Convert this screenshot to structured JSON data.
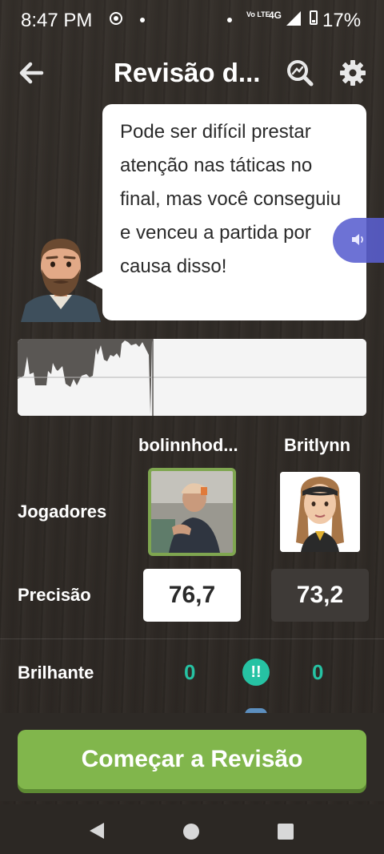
{
  "status_bar": {
    "time": "8:47 PM",
    "network_volte": "Vo LTE",
    "network_type": "4G",
    "battery": "17%"
  },
  "header": {
    "title": "Revisão d...",
    "back_icon": "arrow-left-icon",
    "search_icon": "magnifier-icon",
    "settings_icon": "gear-icon"
  },
  "coach": {
    "message": "Pode ser difícil prestar atenção nas táticas no final, mas você conseguiu e venceu a partida por causa disso!",
    "audio_icon": "speaker-icon"
  },
  "players": {
    "player1_name": "bolinnhod...",
    "player2_name": "Britlynn"
  },
  "labels": {
    "players": "Jogadores",
    "accuracy": "Precisão",
    "brilliant": "Brilhante"
  },
  "accuracy": {
    "player1": "76,7",
    "player2": "73,2"
  },
  "brilliant": {
    "player1": "0",
    "player2": "0",
    "icon_text": "!!"
  },
  "actions": {
    "start_review": "Começar a Revisão"
  },
  "colors": {
    "accent_green": "#81b64c",
    "brilliant_teal": "#26c2a3",
    "audio_purple": "#5a5fd0"
  }
}
